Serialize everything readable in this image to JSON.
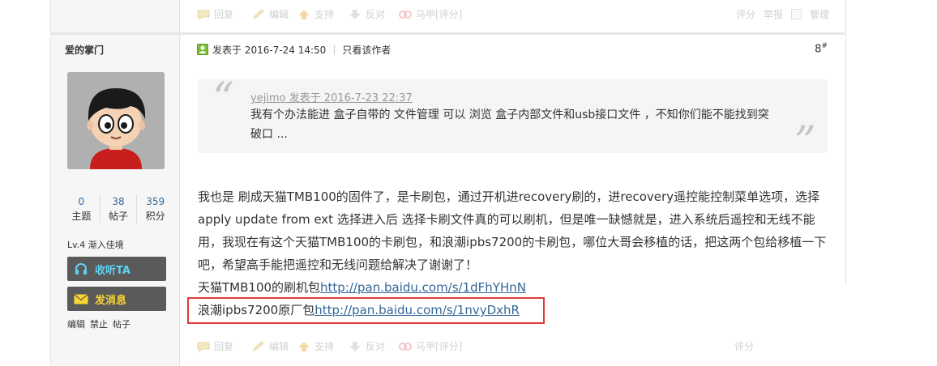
{
  "toolbar": {
    "reply": "回复",
    "edit": "编辑",
    "support": "支持",
    "oppose": "反对",
    "alias": "马甲[评分]",
    "rate": "评分",
    "report": "举报",
    "manage": "管理"
  },
  "author": {
    "name": "爱的掌门",
    "stats": [
      {
        "value": "0",
        "label": "主题"
      },
      {
        "value": "38",
        "label": "帖子"
      },
      {
        "value": "359",
        "label": "积分"
      }
    ],
    "level": "Lv.4 渐入佳境",
    "listen_button": "收听TA",
    "message_button": "发消息",
    "admin_links": [
      "编辑",
      "禁止",
      "帖子"
    ]
  },
  "post": {
    "posted_at": "发表于 2016-7-24 14:50",
    "only_author": "只看该作者",
    "floor": "8",
    "floor_mark": "#",
    "quote": {
      "meta": "yejimo 发表于 2016-7-23 22:37",
      "text": "我有个办法能进 盒子自带的 文件管理  可以 浏览 盒子内部文件和usb接口文件  ，不知你们能不能找到突破口 ..."
    },
    "body": "我也是 刷成天猫TMB100的固件了，是卡刷包，通过开机进recovery刷的，进recovery遥控能控制菜单选项，选择apply update from ext  选择进入后 选择卡刷文件真的可以刷机，但是唯一缺憾就是，进入系统后遥控和无线不能用，我现在有这个天猫TMB100的卡刷包，和浪潮ipbs7200的卡刷包，哪位大哥会移植的话，把这两个包给移植一下吧，希望高手能把遥控和无线问题给解决了谢谢了！",
    "link1_label": "天猫TMB100的刷机包",
    "link1_url": "http://pan.baidu.com/s/1dFhYHnN",
    "link2_label": "浪潮ipbs7200原厂包",
    "link2_url": "http://pan.baidu.com/s/1nvyDxhR"
  },
  "bottom_toolbar": {
    "reply": "回复",
    "edit": "编辑",
    "support": "支持",
    "oppose": "反对",
    "alias": "马甲[评分]",
    "rate": "评分"
  },
  "colors": {
    "link": "#336699",
    "button_bg": "#5a5a5a",
    "button_text": "#fbd531",
    "highlight": "#e03a3a"
  }
}
